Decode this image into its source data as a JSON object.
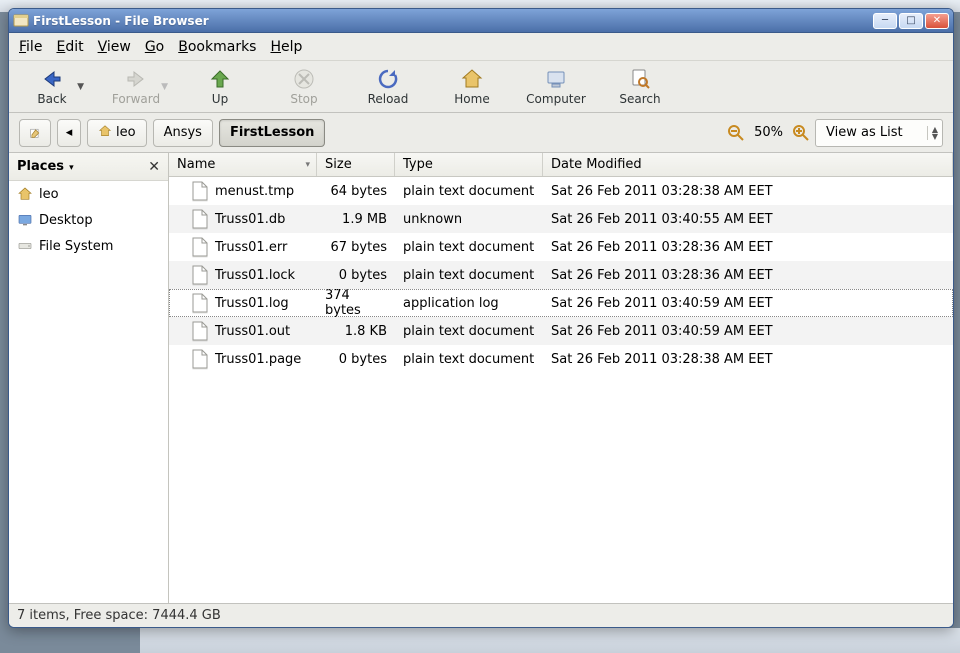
{
  "window": {
    "title": "FirstLesson - File Browser"
  },
  "menubar": {
    "file": "File",
    "edit": "Edit",
    "view": "View",
    "go": "Go",
    "bookmarks": "Bookmarks",
    "help": "Help"
  },
  "toolbar": {
    "back": "Back",
    "forward": "Forward",
    "up": "Up",
    "stop": "Stop",
    "reload": "Reload",
    "home": "Home",
    "computer": "Computer",
    "search": "Search"
  },
  "location": {
    "crumb_home": "leo",
    "crumb_1": "Ansys",
    "crumb_2": "FirstLesson",
    "zoom": "50%",
    "view_mode": "View as List"
  },
  "sidebar": {
    "header": "Places",
    "items": [
      {
        "label": "leo"
      },
      {
        "label": "Desktop"
      },
      {
        "label": "File System"
      }
    ]
  },
  "columns": {
    "name": "Name",
    "size": "Size",
    "type": "Type",
    "date": "Date Modified"
  },
  "files": [
    {
      "name": "menust.tmp",
      "size": "64 bytes",
      "type": "plain text document",
      "date": "Sat 26 Feb 2011 03:28:38 AM EET"
    },
    {
      "name": "Truss01.db",
      "size": "1.9 MB",
      "type": "unknown",
      "date": "Sat 26 Feb 2011 03:40:55 AM EET"
    },
    {
      "name": "Truss01.err",
      "size": "67 bytes",
      "type": "plain text document",
      "date": "Sat 26 Feb 2011 03:28:36 AM EET"
    },
    {
      "name": "Truss01.lock",
      "size": "0 bytes",
      "type": "plain text document",
      "date": "Sat 26 Feb 2011 03:28:36 AM EET"
    },
    {
      "name": "Truss01.log",
      "size": "374 bytes",
      "type": "application log",
      "date": "Sat 26 Feb 2011 03:40:59 AM EET"
    },
    {
      "name": "Truss01.out",
      "size": "1.8 KB",
      "type": "plain text document",
      "date": "Sat 26 Feb 2011 03:40:59 AM EET"
    },
    {
      "name": "Truss01.page",
      "size": "0 bytes",
      "type": "plain text document",
      "date": "Sat 26 Feb 2011 03:28:38 AM EET"
    }
  ],
  "status": "7 items, Free space: 7444.4 GB"
}
